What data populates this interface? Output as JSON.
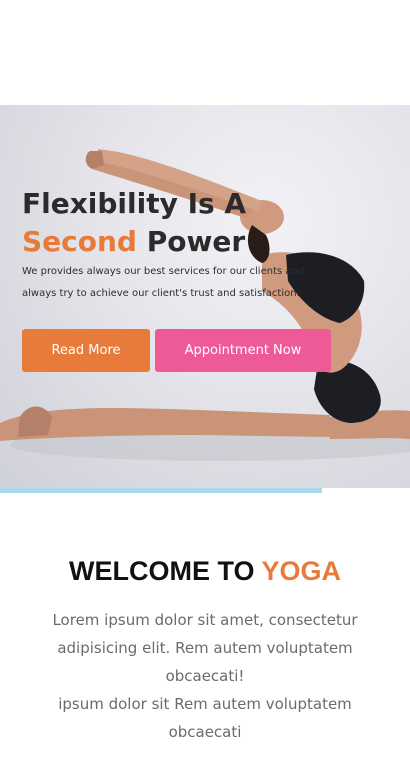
{
  "hero": {
    "title_line1": "Flexibility Is A",
    "title_accent": "Second",
    "title_rest": "Power",
    "subtitle_line1": "We provides always our best services for our clients and",
    "subtitle_line2": "always try to achieve our client's trust and satisfaction.",
    "read_more_label": "Read More",
    "appointment_label": "Appointment Now"
  },
  "slider_progress": 0.785,
  "welcome": {
    "title_main": "WELCOME TO",
    "title_accent": "YOGA",
    "text_line1": "Lorem ipsum dolor sit amet, consectetur",
    "text_line2": "adipisicing elit. Rem autem voluptatem",
    "text_line3": "obcaecati!",
    "text_line4": "ipsum dolor sit Rem autem voluptatem",
    "text_line5": "obcaecati"
  },
  "colors": {
    "accent": "#e87b3a",
    "pink": "#ee5a98",
    "progress": "#a8d9ea"
  }
}
